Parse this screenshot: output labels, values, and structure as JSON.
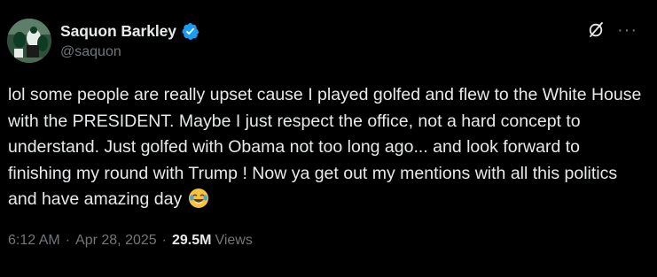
{
  "author": {
    "display_name": "Saquon Barkley",
    "handle": "@saquon",
    "avatar_icon": "profile-photo",
    "verified_icon": "verified-badge-icon",
    "verified_color": "#1d9bf0"
  },
  "header_actions": {
    "grok_icon": "grok-icon",
    "more_label": "···"
  },
  "tweet": {
    "text": "lol some people are really upset cause I played golfed and flew to the White House with the PRESIDENT. Maybe I just respect the office, not a hard concept to understand. Just golfed with Obama not too long ago... and look forward to finishing my round with Trump ! Now ya get out my mentions with all this politics and have amazing day",
    "emoji": "face-with-tears-of-joy"
  },
  "meta": {
    "time": "6:12 AM",
    "separator": "·",
    "date": "Apr 28, 2025",
    "views_count": "29.5M",
    "views_label": "Views"
  },
  "colors": {
    "background": "#000000",
    "text_primary": "#e7e9ea",
    "text_secondary": "#71767b"
  }
}
